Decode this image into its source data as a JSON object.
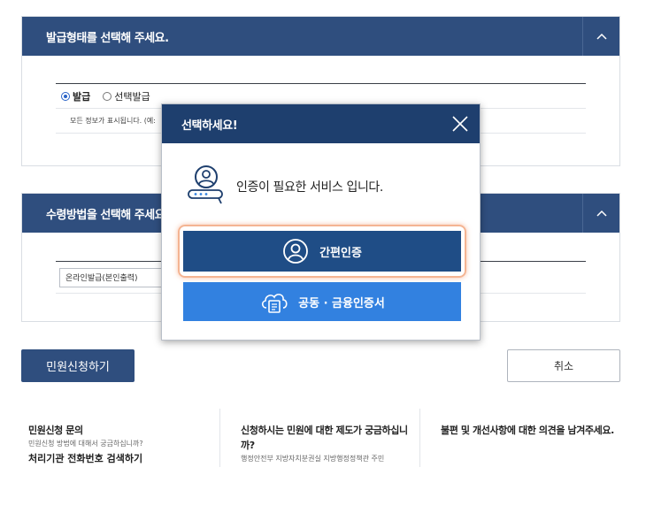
{
  "section_issue": {
    "title": "발급형태를 선택해 주세요.",
    "radio_issue": "발급",
    "radio_select_issue": "선택발급",
    "info_text": "모든 정보가 표시됩니다. (예:"
  },
  "section_receive": {
    "title": "수령방법을 선택해 주세요",
    "method_value": "온라인발급(본인출력)"
  },
  "actions": {
    "apply_label": "민원신청하기",
    "cancel_label": "취소"
  },
  "footer": {
    "col1_title": "민원신청 문의",
    "col1_sub": "민원신청 방법에 대해서 궁금하십니까?",
    "col1_link": "처리기관 전화번호 검색하기",
    "col2_title": "신청하시는 민원에 대한 제도가 궁금하십니까?",
    "col2_sub": "행정안전부 지방자치분권실 지방행정정책관 주민",
    "col3_title": "불편 및 개선사항에 대한 의견을 남겨주세요."
  },
  "modal": {
    "title": "선택하세요!",
    "message": "인증이 필요한 서비스 입니다.",
    "simple_auth_label": "간편인증",
    "cert_auth_label": "공동 · 금융인증서"
  },
  "colors": {
    "header_navy": "#2f4e7e",
    "modal_header": "#1e3f6e",
    "simple_button": "#1f4d86",
    "cert_button": "#3281e0",
    "highlight_orange": "#f4b492"
  },
  "icons": {
    "collapse": "chevron-up-icon",
    "close": "close-icon",
    "auth": "user-key-icon",
    "simple": "user-circle-icon",
    "cert": "cloud-certificate-icon"
  }
}
